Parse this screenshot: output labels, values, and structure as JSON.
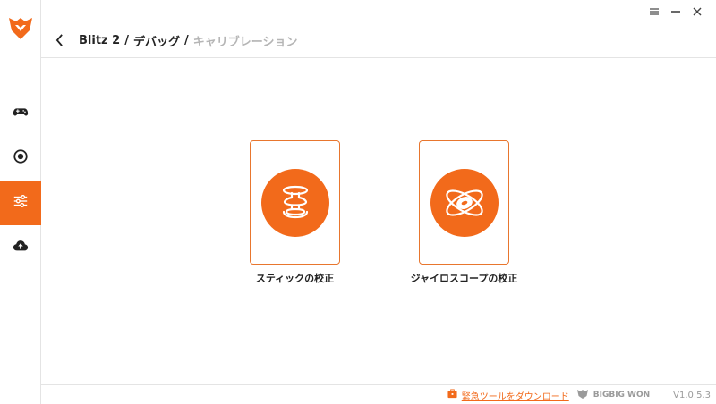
{
  "colors": {
    "accent": "#f26a1b",
    "sidebar_border": "#e4e4e4",
    "muted": "#b5b5b5"
  },
  "sidebar": {
    "logo_icon": "bigbigwon-logo-icon",
    "items": [
      {
        "icon": "gamepad-icon",
        "active": false
      },
      {
        "icon": "record-icon",
        "active": false
      },
      {
        "icon": "sliders-icon",
        "active": true
      },
      {
        "icon": "cloud-upload-icon",
        "active": false
      }
    ]
  },
  "window_controls": [
    "menu-icon",
    "minimize-icon",
    "close-icon"
  ],
  "breadcrumb": {
    "device": "Blitz 2",
    "section": "デバッグ",
    "current": "キャリブレーション",
    "separator": "/"
  },
  "cards": [
    {
      "icon": "stick-calibration-icon",
      "label": "スティックの校正"
    },
    {
      "icon": "gyroscope-icon",
      "label": "ジャイロスコープの校正"
    }
  ],
  "footer": {
    "download_link": "緊急ツールをダウンロード",
    "brand": "BIGBIG WON",
    "version": "V1.0.5.3"
  }
}
